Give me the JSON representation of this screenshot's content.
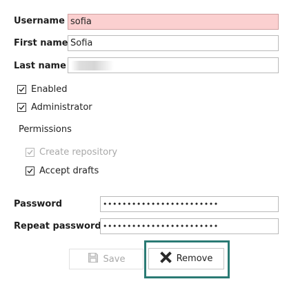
{
  "form": {
    "username_label": "Username",
    "username_value": "sofia",
    "firstname_label": "First name",
    "firstname_value": "Sofia",
    "lastname_label": "Last name",
    "lastname_value": "",
    "enabled_label": "Enabled",
    "enabled_checked": true,
    "admin_label": "Administrator",
    "admin_checked": true,
    "permissions_label": "Permissions",
    "create_repo_label": "Create repository",
    "create_repo_checked": true,
    "create_repo_disabled": true,
    "accept_drafts_label": "Accept drafts",
    "accept_drafts_checked": true,
    "password_label": "Password",
    "password_value": "••••••••••••••••••••••••",
    "repeat_password_label": "Repeat password",
    "repeat_password_value": "••••••••••••••••••••••••"
  },
  "buttons": {
    "save_label": "Save",
    "save_icon": "floppy-disk-icon",
    "remove_label": "Remove",
    "remove_icon": "x-icon"
  },
  "colors": {
    "error_field_bg": "#fbd0d0",
    "highlight_border": "#2a7a74"
  }
}
